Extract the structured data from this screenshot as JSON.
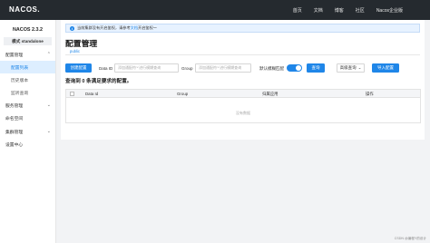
{
  "app": {
    "logo": "NACOS.",
    "top_nav": [
      "首页",
      "文档",
      "博客",
      "社区",
      "Nacos企业版"
    ]
  },
  "sidebar": {
    "version": "NACOS 2.3.2",
    "mode": "模式 standalone",
    "groups": [
      {
        "label": "配置管理",
        "items": [
          "配置列表",
          "历史版本",
          "监听查询"
        ]
      },
      {
        "label": "服务管理",
        "items": []
      }
    ],
    "namespace": "命名空间",
    "cluster": "集群管理",
    "settings": "设置中心"
  },
  "notice": {
    "text": "当前集群没有开启鉴权，请参考",
    "link": "文档",
    "text_after": "开启鉴权～"
  },
  "page": {
    "title": "配置管理",
    "namespace_tab": "public"
  },
  "filters": {
    "create_button": "创建配置",
    "data_id_label": "Data ID",
    "data_id_placeholder": "添加通配符'*'进行模糊查询",
    "group_label": "Group",
    "group_placeholder": "添加通配符'*'进行模糊查询",
    "fuzzy_label": "默认模糊匹配",
    "fuzzy_on": true,
    "search_button": "查询",
    "advanced_button": "高级查询",
    "import_button": "导入配置"
  },
  "summary": {
    "prefix": "查询到",
    "count": "0",
    "suffix": "条满足要求的配置。"
  },
  "table": {
    "columns": [
      "Data Id",
      "Group",
      "归属应用",
      "操作"
    ],
    "empty_text": "没有数据"
  },
  "watermark": "CSDN @编程Y的设计",
  "colors": {
    "topbar": "#252a2f",
    "primary": "#1f86e8",
    "active_nav_bg": "#ddeeff"
  }
}
